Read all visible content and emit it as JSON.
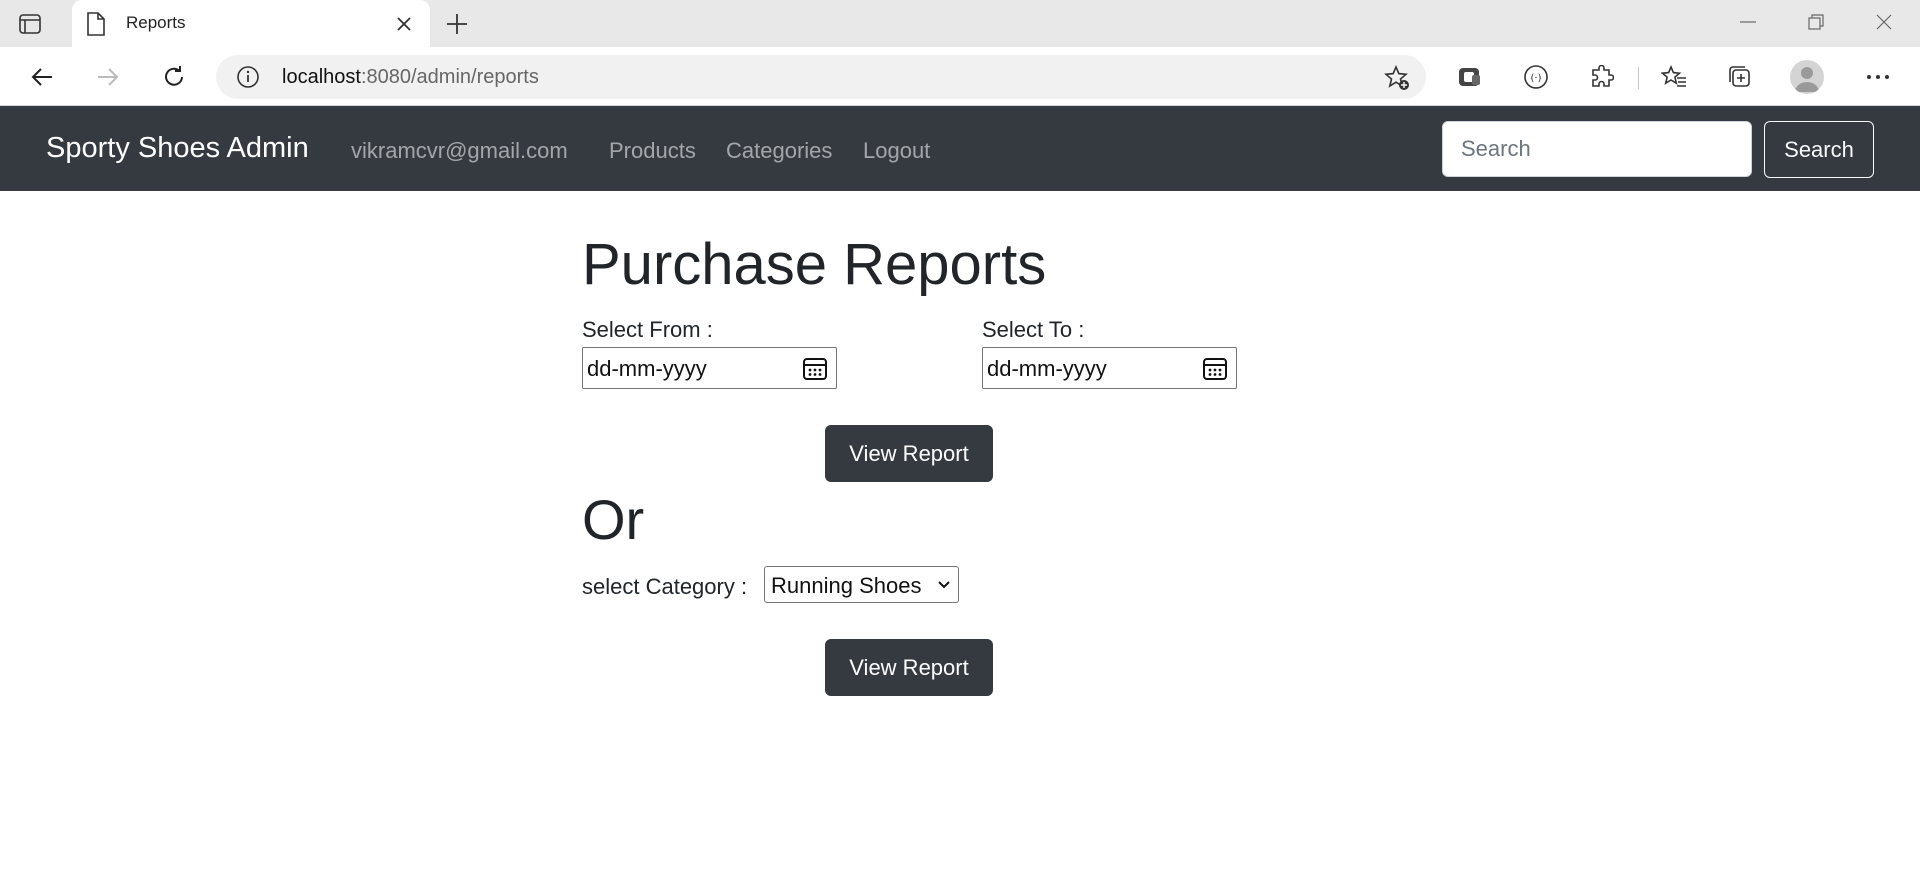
{
  "browser": {
    "tab_title": "Reports",
    "url_host": "localhost",
    "url_path": ":8080/admin/reports"
  },
  "navbar": {
    "brand": "Sporty Shoes Admin",
    "links": [
      "vikramcvr@gmail.com",
      "Products",
      "Categories",
      "Logout"
    ],
    "search_placeholder": "Search",
    "search_button": "Search",
    "background": "#343a40"
  },
  "main": {
    "title": "Purchase Reports",
    "from_label": "Select From :",
    "to_label": "Select To :",
    "date_placeholder": "dd-mm-yyyy",
    "view_report_label": "View Report",
    "or_label": "Or",
    "category_label": "select Category :",
    "category_selected": "Running Shoes"
  },
  "icons": {
    "tab_actions": "tab-actions-icon",
    "tab_page": "page-icon",
    "calendar": "calendar-icon",
    "chevron": "chevron-down-icon"
  }
}
